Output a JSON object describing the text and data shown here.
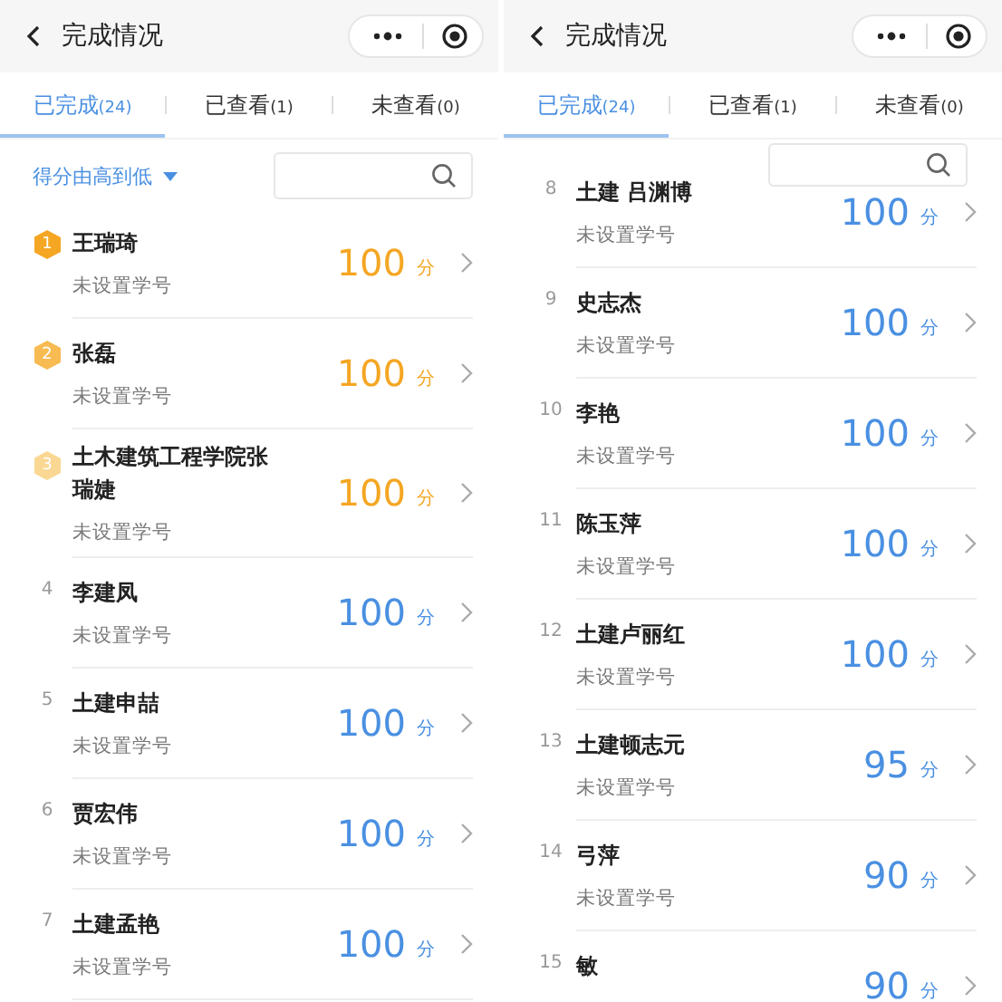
{
  "panels": [
    {
      "title": "完成情况",
      "tabs": [
        {
          "label": "已完成",
          "count": "(24)",
          "selected": true
        },
        {
          "label": "已查看",
          "count": "(1)",
          "selected": false
        },
        {
          "label": "未查看",
          "count": "(0)",
          "selected": false
        }
      ],
      "sort_label": "得分由高到低",
      "rows": [
        {
          "kind": "medal",
          "rank": "1",
          "color": "#f5a623",
          "name": "王瑞琦",
          "subtitle": "未设置学号",
          "score": "100",
          "unit": "分"
        },
        {
          "kind": "medal",
          "rank": "2",
          "color": "#f7bb52",
          "name": "张磊",
          "subtitle": "未设置学号",
          "score": "100",
          "unit": "分"
        },
        {
          "kind": "medal",
          "rank": "3",
          "color": "#fad792",
          "name": "土木建筑工程学院张瑞婕",
          "subtitle": "未设置学号",
          "score": "100",
          "unit": "分"
        },
        {
          "kind": "number",
          "rank": "4",
          "name": "李建凤",
          "subtitle": "未设置学号",
          "score": "100",
          "unit": "分"
        },
        {
          "kind": "number",
          "rank": "5",
          "name": "土建申喆",
          "subtitle": "未设置学号",
          "score": "100",
          "unit": "分"
        },
        {
          "kind": "number",
          "rank": "6",
          "name": "贾宏伟",
          "subtitle": "未设置学号",
          "score": "100",
          "unit": "分"
        },
        {
          "kind": "number",
          "rank": "7",
          "name": "土建孟艳",
          "subtitle": "未设置学号",
          "score": "100",
          "unit": "分"
        }
      ]
    },
    {
      "title": "完成情况",
      "tabs": [
        {
          "label": "已完成",
          "count": "(24)",
          "selected": true
        },
        {
          "label": "已查看",
          "count": "(1)",
          "selected": false
        },
        {
          "label": "未查看",
          "count": "(0)",
          "selected": false
        }
      ],
      "rows": [
        {
          "kind": "number",
          "rank": "8",
          "name": "土建 吕渊博",
          "subtitle": "未设置学号",
          "score": "100",
          "unit": "分"
        },
        {
          "kind": "number",
          "rank": "9",
          "name": "史志杰",
          "subtitle": "未设置学号",
          "score": "100",
          "unit": "分"
        },
        {
          "kind": "number",
          "rank": "10",
          "name": "李艳",
          "subtitle": "未设置学号",
          "score": "100",
          "unit": "分"
        },
        {
          "kind": "number",
          "rank": "11",
          "name": "陈玉萍",
          "subtitle": "未设置学号",
          "score": "100",
          "unit": "分"
        },
        {
          "kind": "number",
          "rank": "12",
          "name": "土建卢丽红",
          "subtitle": "未设置学号",
          "score": "100",
          "unit": "分"
        },
        {
          "kind": "number",
          "rank": "13",
          "name": "土建顿志元",
          "subtitle": "未设置学号",
          "score": "95",
          "unit": "分"
        },
        {
          "kind": "number",
          "rank": "14",
          "name": "弓萍",
          "subtitle": "未设置学号",
          "score": "90",
          "unit": "分"
        },
        {
          "kind": "number",
          "rank": "15",
          "name": "敏",
          "score": "90",
          "unit": "分"
        }
      ]
    }
  ]
}
